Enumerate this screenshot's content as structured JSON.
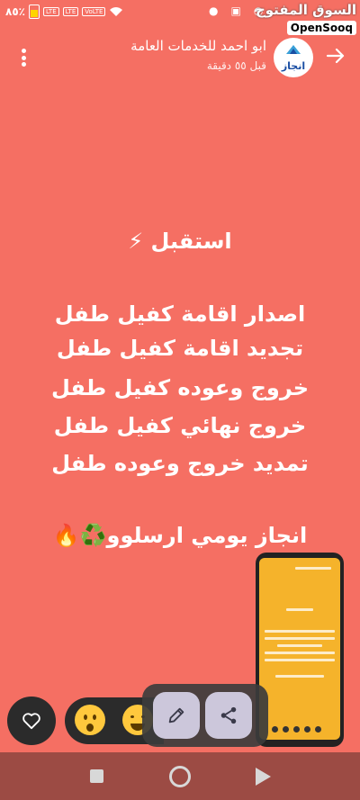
{
  "status_bar": {
    "battery_text": "٨٥٪",
    "network_tags": [
      "LTE",
      "LTE",
      "VoLTE"
    ]
  },
  "watermark": {
    "arabic": "السوق المفتوح",
    "english": "OpenSooq"
  },
  "header": {
    "title": "ابو احمد للخدمات العامة",
    "time_ago": "قبل ٥٥ دقيقة",
    "avatar_label": "انجاز"
  },
  "story": {
    "lines": [
      "استقبل ⚡",
      "اصدار اقامة كفيل طفل",
      "تجديد اقامة كفيل طفل",
      "خروج وعوده كفيل طفل",
      "خروج نهائي كفيل طفل",
      "تمديد خروج وعوده طفل",
      "انجاز يومي ارسلوو♻️🔥"
    ]
  },
  "icons": {
    "back": "arrow-right-icon",
    "menu": "more-vertical-icon",
    "like": "heart-icon",
    "edit": "pencil-icon",
    "share": "share-icon"
  },
  "colors": {
    "background": "#f56f63",
    "nav_bar": "#9c4b44",
    "dark_panel": "#2b2b2b",
    "preview_story": "#f5b32b"
  }
}
